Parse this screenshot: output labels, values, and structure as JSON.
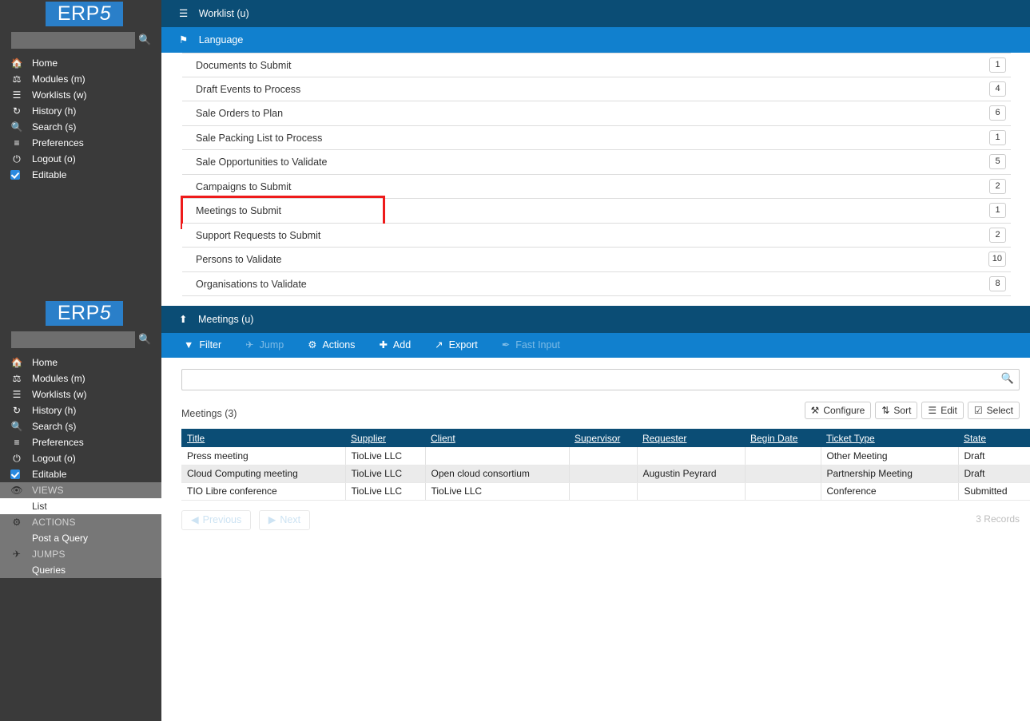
{
  "brand": {
    "name": "ERP5",
    "prefix": "ERP",
    "suffix": "5",
    "color": "#2a7fc9"
  },
  "sidebar": {
    "search_placeholder": "",
    "search_value": "",
    "search_icon": "search-icon",
    "items": [
      {
        "label": "Home",
        "icon": "home-icon"
      },
      {
        "label": "Modules (m)",
        "icon": "modules-icon"
      },
      {
        "label": "Worklists (w)",
        "icon": "worklists-icon"
      },
      {
        "label": "History (h)",
        "icon": "history-icon"
      },
      {
        "label": "Search (s)",
        "icon": "search-icon"
      },
      {
        "label": "Preferences",
        "icon": "sliders-icon"
      },
      {
        "label": "Logout (o)",
        "icon": "power-icon"
      },
      {
        "label": "Editable",
        "icon": "checkbox-checked-icon"
      }
    ],
    "sections": [
      {
        "label": "VIEWS",
        "icon": "eye-icon",
        "links": [
          {
            "label": "List",
            "selected": true
          }
        ]
      },
      {
        "label": "ACTIONS",
        "icon": "gear-icon",
        "links": [
          {
            "label": "Post a Query",
            "selected": false
          }
        ]
      },
      {
        "label": "JUMPS",
        "icon": "plane-icon",
        "links": [
          {
            "label": "Queries",
            "selected": false
          }
        ]
      }
    ]
  },
  "header": {
    "worklist_title": "Worklist (u)",
    "worklist_icon": "worklists-icon",
    "language_title": "Language",
    "language_icon": "flag-icon",
    "dark_color": "#0b4d75",
    "blue_color": "#1180ce"
  },
  "worklist": {
    "highlight_color": "#ee1b1b",
    "rows": [
      {
        "label": "Documents to Submit",
        "count": "1",
        "highlight": false
      },
      {
        "label": "Draft Events to Process",
        "count": "4",
        "highlight": false
      },
      {
        "label": "Sale Orders to Plan",
        "count": "6",
        "highlight": false
      },
      {
        "label": "Sale Packing List to Process",
        "count": "1",
        "highlight": false
      },
      {
        "label": "Sale Opportunities to Validate",
        "count": "5",
        "highlight": false
      },
      {
        "label": "Campaigns to Submit",
        "count": "2",
        "highlight": false
      },
      {
        "label": "Meetings to Submit",
        "count": "1",
        "highlight": true
      },
      {
        "label": "Support Requests to Submit",
        "count": "2",
        "highlight": false
      },
      {
        "label": "Persons to Validate",
        "count": "10",
        "highlight": false
      },
      {
        "label": "Organisations to Validate",
        "count": "8",
        "highlight": false
      }
    ]
  },
  "meetings": {
    "panel_title": "Meetings (u)",
    "panel_icon": "arrow-up-icon",
    "toolbar": [
      {
        "label": "Filter",
        "icon": "filter-icon",
        "disabled": false
      },
      {
        "label": "Jump",
        "icon": "plane-icon",
        "disabled": true
      },
      {
        "label": "Actions",
        "icon": "gear-icon",
        "disabled": false
      },
      {
        "label": "Add",
        "icon": "plus-icon",
        "disabled": false
      },
      {
        "label": "Export",
        "icon": "export-icon",
        "disabled": false
      },
      {
        "label": "Fast Input",
        "icon": "pencil-icon",
        "disabled": true
      }
    ],
    "search": {
      "value": "",
      "placeholder": "",
      "icon": "search-icon"
    },
    "list_title": "Meetings (3)",
    "head_buttons": [
      {
        "label": "Configure",
        "icon": "wrench-icon"
      },
      {
        "label": "Sort",
        "icon": "sort-icon"
      },
      {
        "label": "Edit",
        "icon": "list-icon"
      },
      {
        "label": "Select",
        "icon": "check-square-icon"
      }
    ],
    "columns": [
      "Title",
      "Supplier",
      "Client",
      "Supervisor",
      "Requester",
      "Begin Date",
      "Ticket Type",
      "State"
    ],
    "rows": [
      {
        "Title": "Press meeting",
        "Supplier": "TioLive LLC",
        "Client": "",
        "Supervisor": "",
        "Requester": "",
        "Begin Date": "",
        "Ticket Type": "Other Meeting",
        "State": "Draft"
      },
      {
        "Title": "Cloud Computing meeting",
        "Supplier": "TioLive LLC",
        "Client": "Open cloud consortium",
        "Supervisor": "",
        "Requester": "Augustin Peyrard",
        "Begin Date": "",
        "Ticket Type": "Partnership Meeting",
        "State": "Draft"
      },
      {
        "Title": "TIO Libre conference",
        "Supplier": "TioLive LLC",
        "Client": "TioLive LLC",
        "Supervisor": "",
        "Requester": "",
        "Begin Date": "",
        "Ticket Type": "Conference",
        "State": "Submitted"
      }
    ],
    "pager": {
      "previous": "Previous",
      "next": "Next",
      "previous_icon": "triangle-left-icon",
      "next_icon": "triangle-right-icon",
      "records": "3 Records"
    }
  }
}
